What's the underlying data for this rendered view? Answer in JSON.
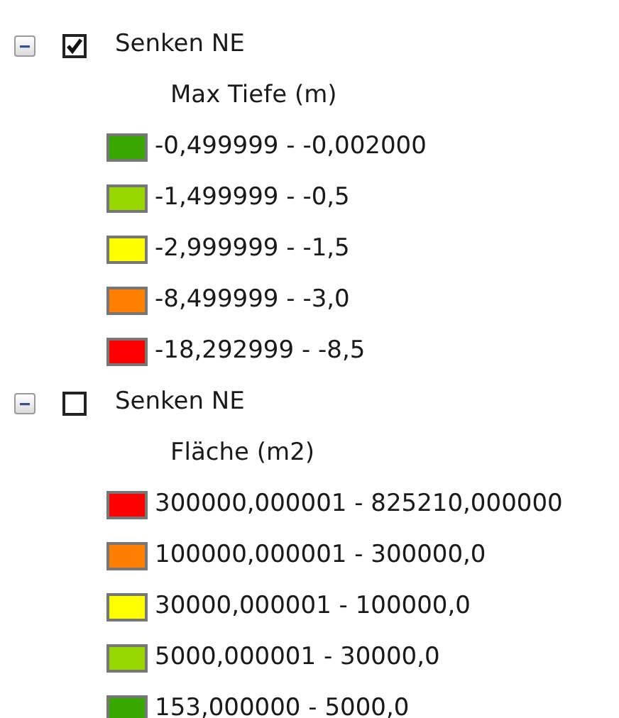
{
  "layers": [
    {
      "name": "Senken NE",
      "expanded": true,
      "checked": true,
      "field": "Max Tiefe (m)",
      "classes": [
        {
          "label": "-0,499999 - -0,002000",
          "color": "#38a800"
        },
        {
          "label": "-1,499999 - -0,5",
          "color": "#98d600"
        },
        {
          "label": "-2,999999 - -1,5",
          "color": "#ffff00"
        },
        {
          "label": "-8,499999 - -3,0",
          "color": "#ff8000"
        },
        {
          "label": "-18,292999 - -8,5",
          "color": "#ff0000"
        }
      ]
    },
    {
      "name": "Senken NE",
      "expanded": true,
      "checked": false,
      "field": "Fläche (m2)",
      "classes": [
        {
          "label": "300000,000001 - 825210,000000",
          "color": "#ff0000"
        },
        {
          "label": "100000,000001 - 300000,0",
          "color": "#ff8000"
        },
        {
          "label": "30000,000001 - 100000,0",
          "color": "#ffff00"
        },
        {
          "label": "5000,000001 - 30000,0",
          "color": "#98d600"
        },
        {
          "label": "153,000000 - 5000,0",
          "color": "#38a800"
        }
      ]
    }
  ]
}
